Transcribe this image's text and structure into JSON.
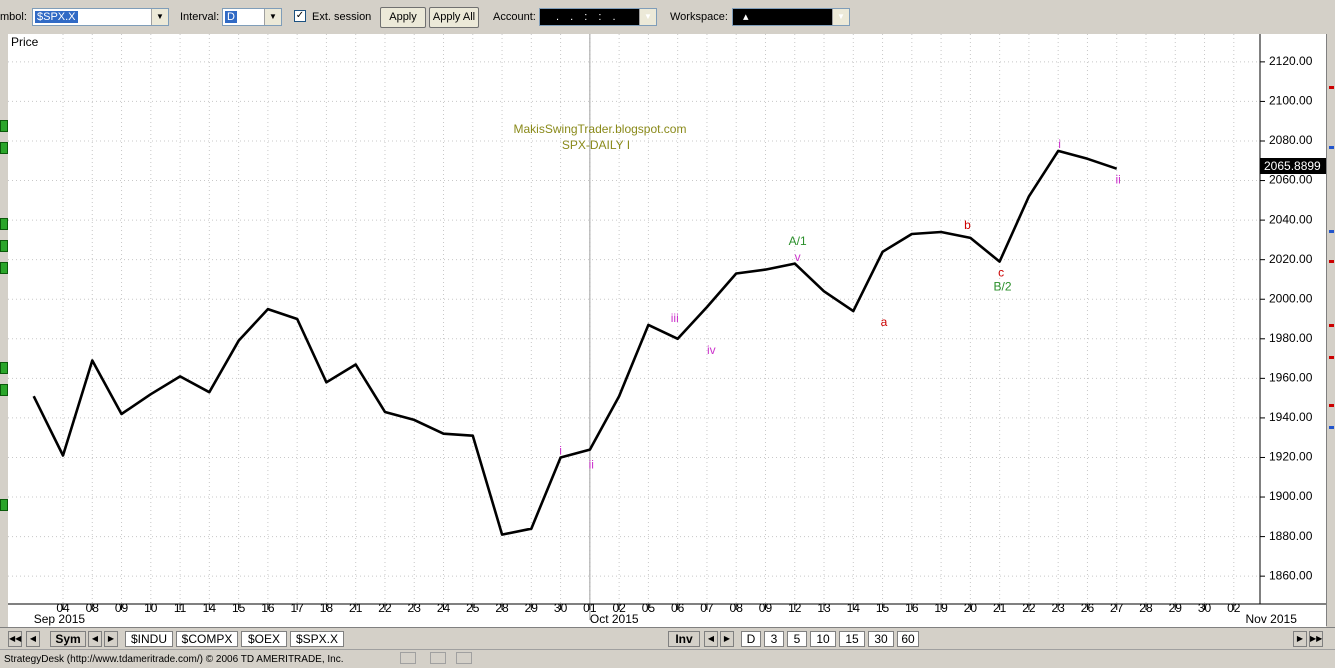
{
  "toolbar": {
    "symbol_label": "mbol:",
    "symbol_value": "$SPX.X",
    "interval_label": "Interval:",
    "interval_value": "D",
    "ext_session_label": "Ext. session",
    "apply_label": "Apply",
    "apply_all_label": "Apply All",
    "account_label": "Account:",
    "account_value": ". . : : .",
    "workspace_label": "Workspace:",
    "workspace_value": "▴"
  },
  "chart_data": {
    "type": "line",
    "title": "MakisSwingTrader.blogspot.com",
    "subtitle": "SPX-DAILY  I",
    "ylabel": "Price",
    "ylim": [
      1845,
      2133
    ],
    "yticks": [
      1860,
      1880,
      1900,
      1920,
      1940,
      1960,
      1980,
      2000,
      2020,
      2040,
      2060,
      2080,
      2100,
      2120
    ],
    "current_price": "2065.8899",
    "x_labels": [
      "04",
      "08",
      "09",
      "10",
      "11",
      "14",
      "15",
      "16",
      "17",
      "18",
      "21",
      "22",
      "23",
      "24",
      "25",
      "28",
      "29",
      "30",
      "01",
      "02",
      "05",
      "06",
      "07",
      "08",
      "09",
      "12",
      "13",
      "14",
      "15",
      "16",
      "19",
      "20",
      "21",
      "22",
      "23",
      "26",
      "27",
      "28",
      "29",
      "30",
      "02"
    ],
    "month_labels": [
      {
        "label": "Sep 2015",
        "at": -1
      },
      {
        "label": "Oct 2015",
        "at": 18
      },
      {
        "label": "Nov 2015",
        "at": 40.4
      }
    ],
    "month_separator_at": 18,
    "series": [
      {
        "color": "#000000",
        "x": [
          -1,
          0,
          1,
          2,
          3,
          4,
          5,
          6,
          7,
          8,
          9,
          10,
          11,
          12,
          13,
          14,
          15,
          16,
          17,
          18,
          19,
          20,
          21,
          22,
          23,
          24,
          25,
          26,
          27,
          28,
          29,
          30,
          31,
          32,
          33,
          34,
          35
        ],
        "values": [
          1951,
          1921,
          1969,
          1942,
          1952,
          1961,
          1953,
          1979,
          1995,
          1990,
          1958,
          1967,
          1943,
          1939,
          1932,
          1931,
          1881,
          1884,
          1920,
          1924,
          1951,
          1987,
          1980,
          1996,
          2013,
          2015,
          2018,
          2004,
          1994,
          2024,
          2033,
          2034,
          2031,
          2019,
          2052,
          2075,
          2071
        ]
      }
    ],
    "last_point": {
      "x": 36,
      "value": 2066
    },
    "annotations": [
      {
        "text": "i",
        "x": 17.0,
        "y": 1923,
        "color": "#cc33cc"
      },
      {
        "text": "ii",
        "x": 18.05,
        "y": 1916,
        "color": "#cc33cc"
      },
      {
        "text": "iii",
        "x": 20.9,
        "y": 1990,
        "color": "#cc33cc"
      },
      {
        "text": "iv",
        "x": 22.15,
        "y": 1974,
        "color": "#cc33cc"
      },
      {
        "text": "A/1",
        "x": 25.1,
        "y": 2029,
        "color": "#2a8f2a"
      },
      {
        "text": "v",
        "x": 25.1,
        "y": 2021,
        "color": "#cc33cc"
      },
      {
        "text": "a",
        "x": 28.05,
        "y": 1988,
        "color": "#cc0000"
      },
      {
        "text": "b",
        "x": 30.9,
        "y": 2037,
        "color": "#cc0000"
      },
      {
        "text": "c",
        "x": 32.05,
        "y": 2013,
        "color": "#cc0000"
      },
      {
        "text": "B/2",
        "x": 32.1,
        "y": 2006,
        "color": "#2a8f2a"
      },
      {
        "text": "i",
        "x": 34.05,
        "y": 2078,
        "color": "#cc33cc"
      },
      {
        "text": "ii",
        "x": 36.05,
        "y": 2060,
        "color": "#cc33cc"
      }
    ]
  },
  "tabs": {
    "sym_label": "Sym",
    "symbols": [
      "$INDU",
      "$COMPX",
      "$OEX",
      "$SPX.X"
    ],
    "inv_label": "Inv",
    "intervals": [
      "D",
      "3",
      "5",
      "10",
      "15",
      "30",
      "60"
    ]
  },
  "status": {
    "text": "StrategyDesk (http://www.tdameritrade.com/) © 2006 TD AMERITRADE, Inc."
  },
  "colors": {
    "accent": "#316ac5",
    "chart_bg": "#ffffff",
    "title_color": "#8a8a1a"
  }
}
